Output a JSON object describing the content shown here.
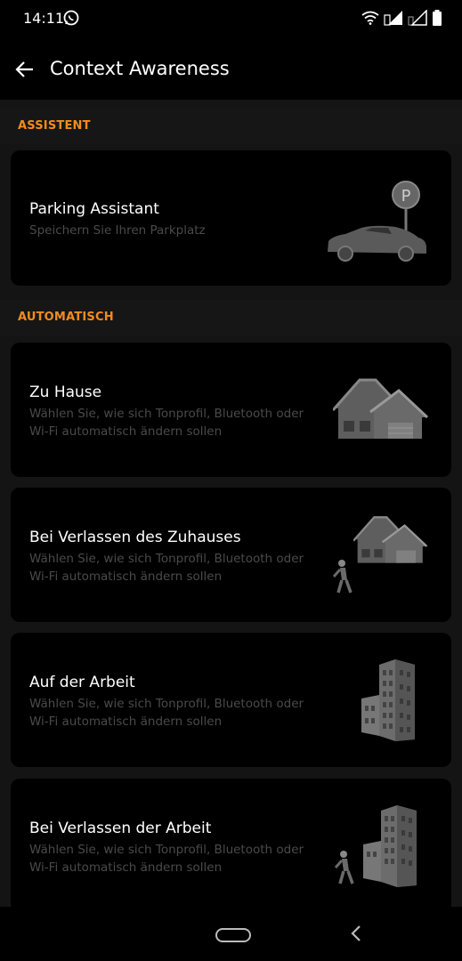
{
  "status": {
    "time": "14:11"
  },
  "header": {
    "title": "Context Awareness"
  },
  "sections": [
    {
      "label": "ASSISTENT"
    },
    {
      "label": "AUTOMATISCH"
    }
  ],
  "cards": [
    {
      "title": "Parking Assistant",
      "subtitle": "Speichern Sie Ihren Parkplatz"
    },
    {
      "title": "Zu Hause",
      "subtitle": "Wählen Sie, wie sich Tonprofil, Bluetooth oder Wi-Fi automatisch ändern sollen"
    },
    {
      "title": "Bei Verlassen des Zuhauses",
      "subtitle": "Wählen Sie, wie sich Tonprofil, Bluetooth oder Wi-Fi automatisch ändern sollen"
    },
    {
      "title": "Auf der Arbeit",
      "subtitle": "Wählen Sie, wie sich Tonprofil, Bluetooth oder Wi-Fi automatisch ändern sollen"
    },
    {
      "title": "Bei Verlassen der Arbeit",
      "subtitle": "Wählen Sie, wie sich Tonprofil, Bluetooth oder Wi-Fi automatisch ändern sollen"
    }
  ],
  "colors": {
    "accent": "#f28c1c",
    "card": "#000000",
    "background": "#141414"
  },
  "icons": [
    "whatsapp-icon",
    "wifi-icon",
    "signal-icon",
    "battery-icon",
    "back-arrow-icon",
    "parking-car-icon",
    "house-icon",
    "walking-person-icon",
    "office-building-icon",
    "home-pill",
    "nav-back-icon"
  ]
}
